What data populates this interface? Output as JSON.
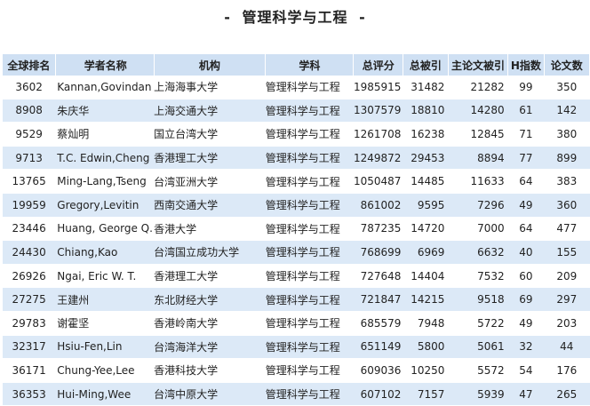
{
  "page": {
    "title": "管理科学与工程",
    "title_dash": "-"
  },
  "table": {
    "headers": [
      "全球排名",
      "学者名称",
      "机构",
      "学科",
      "总评分",
      "总被引",
      "主论文被引",
      "H指数",
      "论文数"
    ],
    "rows": [
      [
        "3602",
        "Kannan,Govindan",
        "上海海事大学",
        "管理科学与工程",
        "1985915",
        "31482",
        "21282",
        "99",
        "350"
      ],
      [
        "8908",
        "朱庆华",
        "上海交通大学",
        "管理科学与工程",
        "1307579",
        "18810",
        "14280",
        "61",
        "142"
      ],
      [
        "9529",
        "蔡灿明",
        "国立台湾大学",
        "管理科学与工程",
        "1261708",
        "16238",
        "12845",
        "71",
        "380"
      ],
      [
        "9713",
        "T.C. Edwin,Cheng",
        "香港理工大学",
        "管理科学与工程",
        "1249872",
        "29453",
        "8894",
        "77",
        "899"
      ],
      [
        "13765",
        "Ming-Lang,Tseng",
        "台湾亚洲大学",
        "管理科学与工程",
        "1050487",
        "14485",
        "11633",
        "64",
        "383"
      ],
      [
        "19959",
        "Gregory,Levitin",
        "西南交通大学",
        "管理科学与工程",
        "861002",
        "9595",
        "7296",
        "49",
        "360"
      ],
      [
        "23446",
        "Huang, George Q.",
        "香港大学",
        "管理科学与工程",
        "787235",
        "14720",
        "7000",
        "64",
        "477"
      ],
      [
        "24430",
        "Chiang,Kao",
        "台湾国立成功大学",
        "管理科学与工程",
        "768699",
        "6969",
        "6632",
        "40",
        "155"
      ],
      [
        "26926",
        "Ngai, Eric W. T.",
        "香港理工大学",
        "管理科学与工程",
        "727648",
        "14404",
        "7532",
        "60",
        "209"
      ],
      [
        "27275",
        "王建州",
        "东北财经大学",
        "管理科学与工程",
        "721847",
        "14215",
        "9518",
        "69",
        "297"
      ],
      [
        "29783",
        "谢霍坚",
        "香港岭南大学",
        "管理科学与工程",
        "685579",
        "7948",
        "5722",
        "49",
        "203"
      ],
      [
        "32317",
        "Hsiu-Fen,Lin",
        "台湾海洋大学",
        "管理科学与工程",
        "651149",
        "5800",
        "5061",
        "32",
        "44"
      ],
      [
        "36171",
        "Chung-Yee,Lee",
        "香港科技大学",
        "管理科学与工程",
        "609036",
        "10250",
        "5572",
        "54",
        "176"
      ],
      [
        "36353",
        "Hui-Ming,Wee",
        "台湾中原大学",
        "管理科学与工程",
        "607102",
        "7157",
        "5939",
        "47",
        "265"
      ]
    ]
  }
}
